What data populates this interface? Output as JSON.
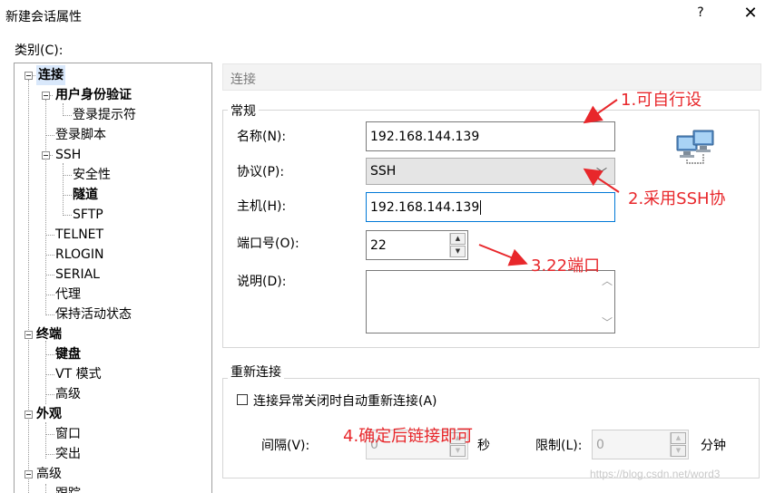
{
  "window": {
    "title": "新建会话属性",
    "help_label": "?",
    "close_label": "✕"
  },
  "category_label": "类别(C):",
  "tree": {
    "items": [
      {
        "label": "连接",
        "bold": true
      },
      {
        "label": "用户身份验证",
        "bold": true
      },
      {
        "label": "登录提示符",
        "bold": false
      },
      {
        "label": "登录脚本",
        "bold": false
      },
      {
        "label": "SSH",
        "bold": false
      },
      {
        "label": "安全性",
        "bold": false
      },
      {
        "label": "隧道",
        "bold": true
      },
      {
        "label": "SFTP",
        "bold": false
      },
      {
        "label": "TELNET",
        "bold": false
      },
      {
        "label": "RLOGIN",
        "bold": false
      },
      {
        "label": "SERIAL",
        "bold": false
      },
      {
        "label": "代理",
        "bold": false
      },
      {
        "label": "保持活动状态",
        "bold": false
      },
      {
        "label": "终端",
        "bold": true
      },
      {
        "label": "键盘",
        "bold": true
      },
      {
        "label": "VT 模式",
        "bold": false
      },
      {
        "label": "高级",
        "bold": false
      },
      {
        "label": "外观",
        "bold": true
      },
      {
        "label": "窗口",
        "bold": false
      },
      {
        "label": "突出",
        "bold": false
      },
      {
        "label": "高级",
        "bold": false
      },
      {
        "label": "跟踪",
        "bold": false
      }
    ]
  },
  "section_title": "连接",
  "general": {
    "group_label": "常规",
    "name_label": "名称(N):",
    "name_value": "192.168.144.139",
    "protocol_label": "协议(P):",
    "protocol_value": "SSH",
    "host_label": "主机(H):",
    "host_value": "192.168.144.139",
    "port_label": "端口号(O):",
    "port_value": "22",
    "desc_label": "说明(D):",
    "desc_value": ""
  },
  "reconnect": {
    "group_label": "重新连接",
    "checkbox_label": "连接异常关闭时自动重新连接(A)",
    "interval_label": "间隔(V):",
    "interval_value": "0",
    "seconds_label": "秒",
    "limit_label": "限制(L):",
    "limit_value": "0",
    "minutes_label": "分钟"
  },
  "annotations": {
    "a1": "1.可自行设",
    "a2": "2.采用SSH协",
    "a3": "3.22端口",
    "a4": "4.确定后链接即可"
  },
  "watermark": "https://blog.csdn.net/word3",
  "colors": {
    "annotation": "#e8272b",
    "focus": "#0078d7"
  }
}
